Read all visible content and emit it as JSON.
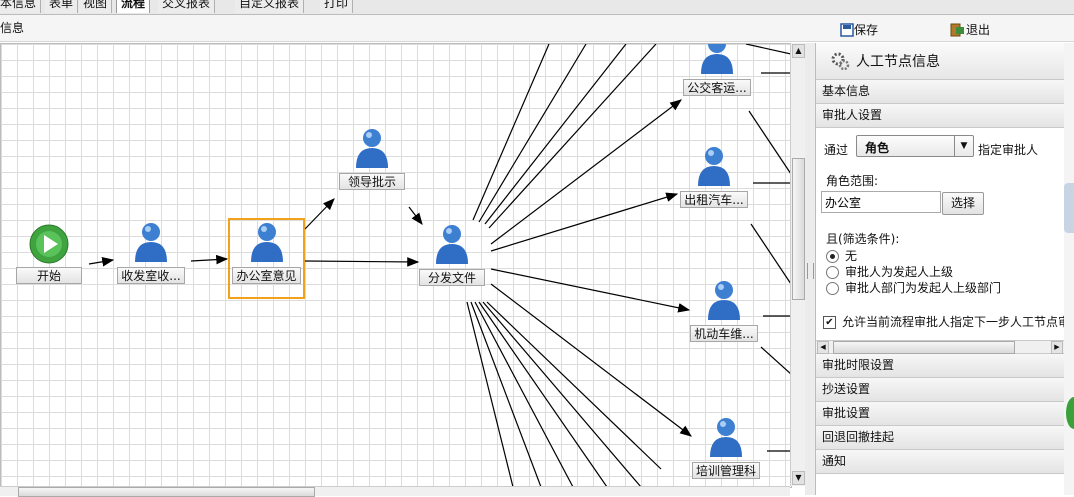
{
  "tabs": [
    {
      "label": "本信息"
    },
    {
      "label": "表单"
    },
    {
      "label": "视图"
    },
    {
      "label": "流程"
    },
    {
      "label": "交叉报表"
    },
    {
      "label": "自定义报表"
    },
    {
      "label": "打印"
    }
  ],
  "subbar": {
    "title": "信息",
    "save_label": "保存",
    "exit_label": "退出"
  },
  "flow": {
    "nodes": [
      {
        "id": "start",
        "label": "开始",
        "icon": "play-icon"
      },
      {
        "id": "receive",
        "label": "收发室收...",
        "icon": "user-icon"
      },
      {
        "id": "office",
        "label": "办公室意见",
        "icon": "user-icon",
        "selected": true
      },
      {
        "id": "leader",
        "label": "领导批示",
        "icon": "user-icon"
      },
      {
        "id": "distribute",
        "label": "分发文件",
        "icon": "user-icon"
      },
      {
        "id": "bus",
        "label": "公交客运...",
        "icon": "user-icon"
      },
      {
        "id": "taxi",
        "label": "出租汽车...",
        "icon": "user-icon"
      },
      {
        "id": "motor",
        "label": "机动车维...",
        "icon": "user-icon"
      },
      {
        "id": "training",
        "label": "培训管理科",
        "icon": "user-icon"
      }
    ]
  },
  "panel": {
    "title": "人工节点信息",
    "sections_top": [
      "基本信息",
      "审批人设置"
    ],
    "approver": {
      "via_label": "通过",
      "select_value": "角色",
      "select_suffix": "指定审批人",
      "scope_label": "角色范围:",
      "scope_value": "办公室",
      "choose_label": "选择",
      "filter_label": "且(筛选条件):",
      "options": [
        {
          "label": "无",
          "checked": true
        },
        {
          "label": "审批人为发起人上级",
          "checked": false
        },
        {
          "label": "审批人部门为发起人上级部门",
          "checked": false
        }
      ],
      "allow_label": "允许当前流程审批人指定下一步人工节点审",
      "allow_checked": true
    },
    "sections_bottom": [
      "审批时限设置",
      "抄送设置",
      "审批设置",
      "回退回撤挂起",
      "通知"
    ]
  }
}
